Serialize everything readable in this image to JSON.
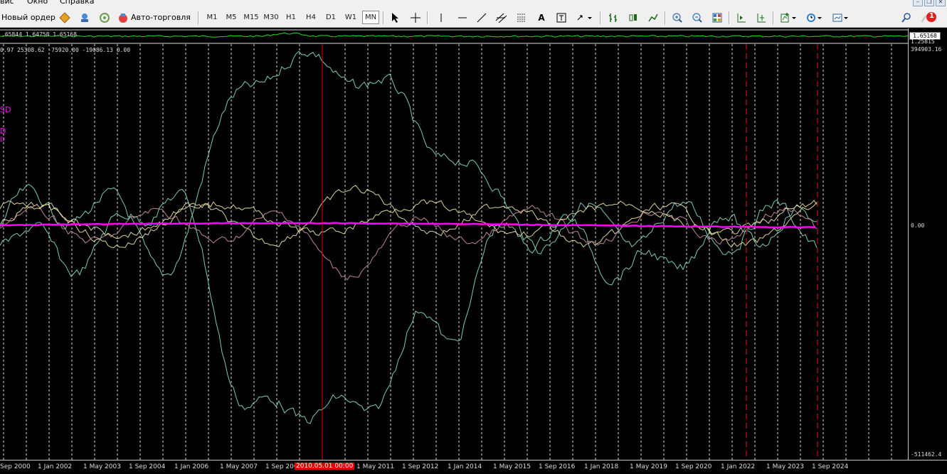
{
  "menu": {
    "items": [
      "вис",
      "Окно",
      "Справка"
    ]
  },
  "toolbar": {
    "new_order_label": "Новый ордер",
    "autotrade_label": "Авто-торговля",
    "timeframes": [
      "M1",
      "M5",
      "M15",
      "M30",
      "H1",
      "H4",
      "D1",
      "W1",
      "MN"
    ],
    "active_timeframe": "MN",
    "text_tool_label": "A",
    "notification_count": "1"
  },
  "chart": {
    "indicator_line_1": ".65844 1.64758 1.65168",
    "indicator_line_2": "0.97 25308.62 -75920.00 -19086.13 0.00",
    "symbol_labels": [
      "SD",
      "D",
      "D"
    ]
  },
  "price_scale": {
    "current_price": "1.65168",
    "labels": {
      "upper_1": "1.25815",
      "upper_2": "394903.16",
      "zero": "0.00",
      "bottom": "-511462.4"
    }
  },
  "time_scale": {
    "labels": [
      "Sep 2000",
      "1 Jan 2002",
      "1 May 2003",
      "1 Sep 2004",
      "1 Jan 2006",
      "1 May 2007",
      "1 Sep 200",
      "2010.05.01 00:00",
      "1 May 2011",
      "1 Sep 2012",
      "1 Jan 2014",
      "1 May 2015",
      "1 Sep 2016",
      "1 Jan 2018",
      "1 May 2019",
      "1 Sep 2020",
      "1 Jan 2022",
      "1 May 2023",
      "1 Sep 2024"
    ],
    "highlighted_label": "2010.05.01 00:00"
  },
  "colors": {
    "background": "#000000",
    "grid": "#ffffff",
    "pink_line": "#ff00ff",
    "cursor_line": "#e00000",
    "dark_red_dashes": "#a01010",
    "teal_series": "#7fd6c0",
    "yellow_series": "#e8e0a0",
    "rose_series": "#c88ca0",
    "green_strip": "#22dd22"
  }
}
